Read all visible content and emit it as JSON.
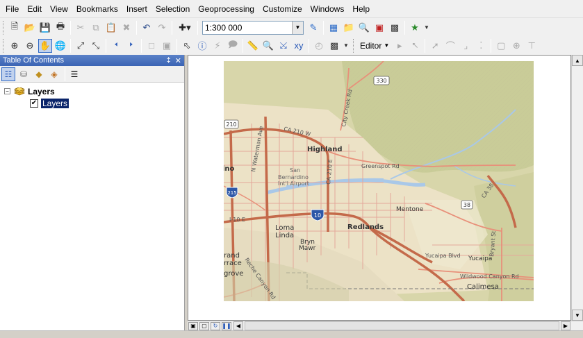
{
  "menubar": {
    "items": [
      "File",
      "Edit",
      "View",
      "Bookmarks",
      "Insert",
      "Selection",
      "Geoprocessing",
      "Customize",
      "Windows",
      "Help"
    ]
  },
  "toolbar": {
    "scale_value": "1:300 000",
    "editor_label": "Editor"
  },
  "toc": {
    "title": "Table Of Contents",
    "pin_label": "‡",
    "close_label": "✕",
    "root_label": "Layers",
    "expander_label": "−",
    "layer_label": "Layers",
    "layer_checked": "✔"
  },
  "map": {
    "places": {
      "highland": "Highland",
      "san": "San",
      "bernardino": "Bernardino",
      "intl": "Int'l Airport",
      "redlands": "Redlands",
      "mentone": "Mentone",
      "loma": "Loma",
      "linda": "Linda",
      "bryn": "Bryn",
      "mawr": "Mawr",
      "yucaipa": "Yucaipa",
      "yucaipa_blvd": "Yucaipa Blvd",
      "calimesa": "Calimesa",
      "greenspot": "Greenspot Rd",
      "wildwood": "Wildwood Canyon Rd",
      "ca210w": "CA 210 W",
      "ca210e": "CA 210 E",
      "i10e": "I-10 E",
      "cityc": "City Creek Rd",
      "waterman": "N Waterman Ave",
      "bryant": "Bryant St",
      "ca38": "CA 38",
      "reche": "Reche Canyon Rd",
      "ino": "ino",
      "rand": "rand",
      "rrace": "rrace",
      "grove": "grove",
      "sh330": "330",
      "sh210": "210",
      "sh38": "38",
      "sh215": "215",
      "sh10": "10"
    }
  },
  "colors": {
    "title_bar": "#3b64b4",
    "map_terrain": "#d8d6aa",
    "map_urban": "#ece2c6",
    "highway": "#c46a4a",
    "water": "#a9c8e8"
  }
}
